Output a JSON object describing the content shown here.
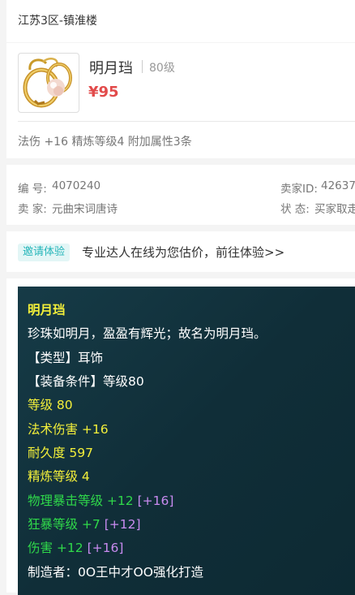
{
  "server": "江苏3区-镇淮楼",
  "item": {
    "name": "明月珰",
    "level": "80级",
    "price": "¥95",
    "attributes": "法伤 +16 精炼等级4 附加属性3条"
  },
  "meta": {
    "id_label": "编  号:",
    "id_value": "4070240",
    "seller_label": "卖  家:",
    "seller_value": "元曲宋词唐诗",
    "seller_id_label": "卖家ID:",
    "seller_id_value": "42637",
    "status_label": "状  态:",
    "status_value": "买家取走"
  },
  "invite": {
    "badge": "邀请体验",
    "text": "专业达人在线为您估价，前往体验>>"
  },
  "tooltip": {
    "title": "明月珰",
    "desc": "珍珠如明月，盈盈有辉光；故名为明月珰。",
    "type": "【类型】耳饰",
    "requirement": "【装备条件】等级80",
    "level": "等级 80",
    "magic_damage": "法术伤害 +16",
    "durability": "耐久度 597",
    "refine": "精炼等级 4",
    "phys_crit": "物理暴击等级 +12",
    "phys_crit_bonus": "[+16]",
    "berserk": "狂暴等级 +7",
    "berserk_bonus": "[+12]",
    "damage": "伤害 +12",
    "damage_bonus": "[+16]",
    "maker": "制造者：0O王中才OO强化打造"
  },
  "colors": {
    "price": "#e24b4b",
    "accent_teal": "#25b5b9",
    "tooltip_bg": "#163b47",
    "tooltip_yellow": "#f3ef3a",
    "tooltip_green": "#2fd84a",
    "tooltip_purple": "#c98bf0"
  }
}
